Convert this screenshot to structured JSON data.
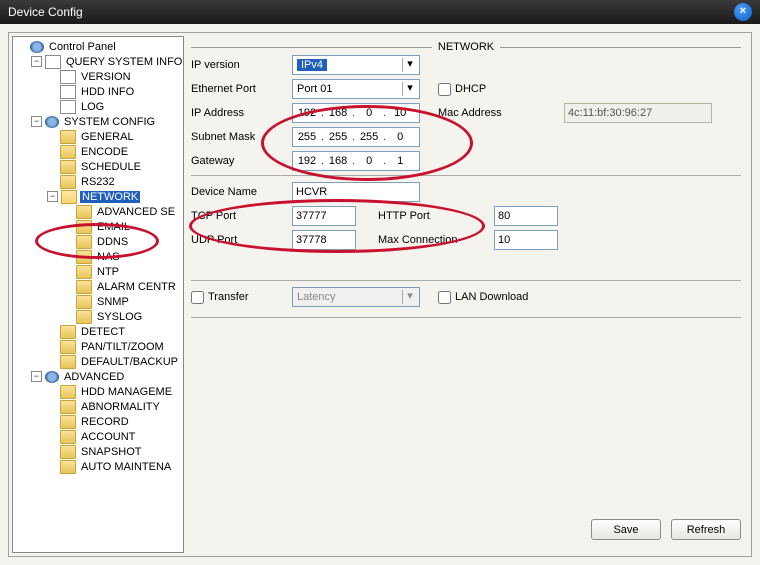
{
  "window": {
    "title": "Device Config"
  },
  "sidebar": {
    "root": "Control Panel",
    "query": {
      "label": "QUERY SYSTEM INFO",
      "children": [
        "VERSION",
        "HDD INFO",
        "LOG"
      ]
    },
    "system": {
      "label": "SYSTEM CONFIG",
      "children_before": [
        "GENERAL",
        "ENCODE",
        "SCHEDULE",
        "RS232"
      ],
      "network": {
        "label": "NETWORK",
        "children": [
          "ADVANCED SE",
          "EMAIL",
          "DDNS",
          "NAS",
          "NTP",
          "ALARM CENTR",
          "SNMP",
          "SYSLOG"
        ]
      },
      "children_after": [
        "DETECT",
        "PAN/TILT/ZOOM",
        "DEFAULT/BACKUP"
      ]
    },
    "advanced": {
      "label": "ADVANCED",
      "children": [
        "HDD MANAGEME",
        "ABNORMALITY",
        "RECORD",
        "ACCOUNT",
        "SNAPSHOT",
        "AUTO MAINTENA"
      ]
    }
  },
  "form": {
    "title": "NETWORK",
    "ip_version_label": "IP version",
    "ip_version_value": "IPv4",
    "eth_port_label": "Ethernet Port",
    "eth_port_value": "Port 01",
    "dhcp_label": "DHCP",
    "ip_address_label": "IP Address",
    "ip_address": [
      "192",
      "168",
      "0",
      "10"
    ],
    "mac_label": "Mac Address",
    "mac_value": "4c:11:bf:30:96:27",
    "subnet_label": "Subnet Mask",
    "subnet": [
      "255",
      "255",
      "255",
      "0"
    ],
    "gateway_label": "Gateway",
    "gateway": [
      "192",
      "168",
      "0",
      "1"
    ],
    "device_name_label": "Device Name",
    "device_name": "HCVR",
    "tcp_port_label": "TCP Port",
    "tcp_port": "37777",
    "http_port_label": "HTTP Port",
    "http_port": "80",
    "udp_port_label": "UDP Port",
    "udp_port": "37778",
    "max_conn_label": "Max Connection",
    "max_conn": "10",
    "transfer_label": "Transfer",
    "transfer_mode": "Latency",
    "lan_dl_label": "LAN Download",
    "save_btn": "Save",
    "refresh_btn": "Refresh"
  }
}
